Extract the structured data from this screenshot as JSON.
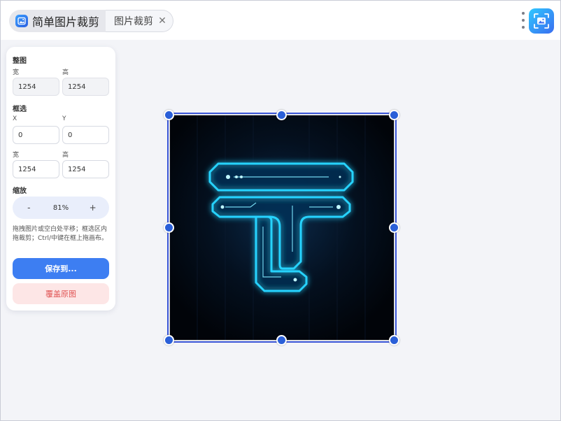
{
  "app": {
    "title": "简单图片裁剪",
    "file_tab_label": "图片裁剪",
    "close_glyph": "✕",
    "accent": "#3d7ef2"
  },
  "panel": {
    "whole_image": {
      "title": "整图",
      "width_label": "宽",
      "height_label": "高",
      "width_value": "1254",
      "height_value": "1254"
    },
    "selection": {
      "title": "框选",
      "x_label": "X",
      "y_label": "Y",
      "x_value": "0",
      "y_value": "0",
      "width_label": "宽",
      "height_label": "高",
      "width_value": "1254",
      "height_value": "1254"
    },
    "zoom": {
      "title": "缩放",
      "minus": "-",
      "value": "81%",
      "plus": "+"
    },
    "hint": "拖拽图片或空白处平移；框选区内拖裁剪；Ctrl/中键在框上拖画布。",
    "save_label": "保存到...",
    "overwrite_label": "覆盖原图",
    "danger_color": "#e05252"
  },
  "icons": {
    "app_logo": "image-icon",
    "corner_logo": "image-scan-icon",
    "more": "more-vertical-icon",
    "close": "close-icon"
  }
}
